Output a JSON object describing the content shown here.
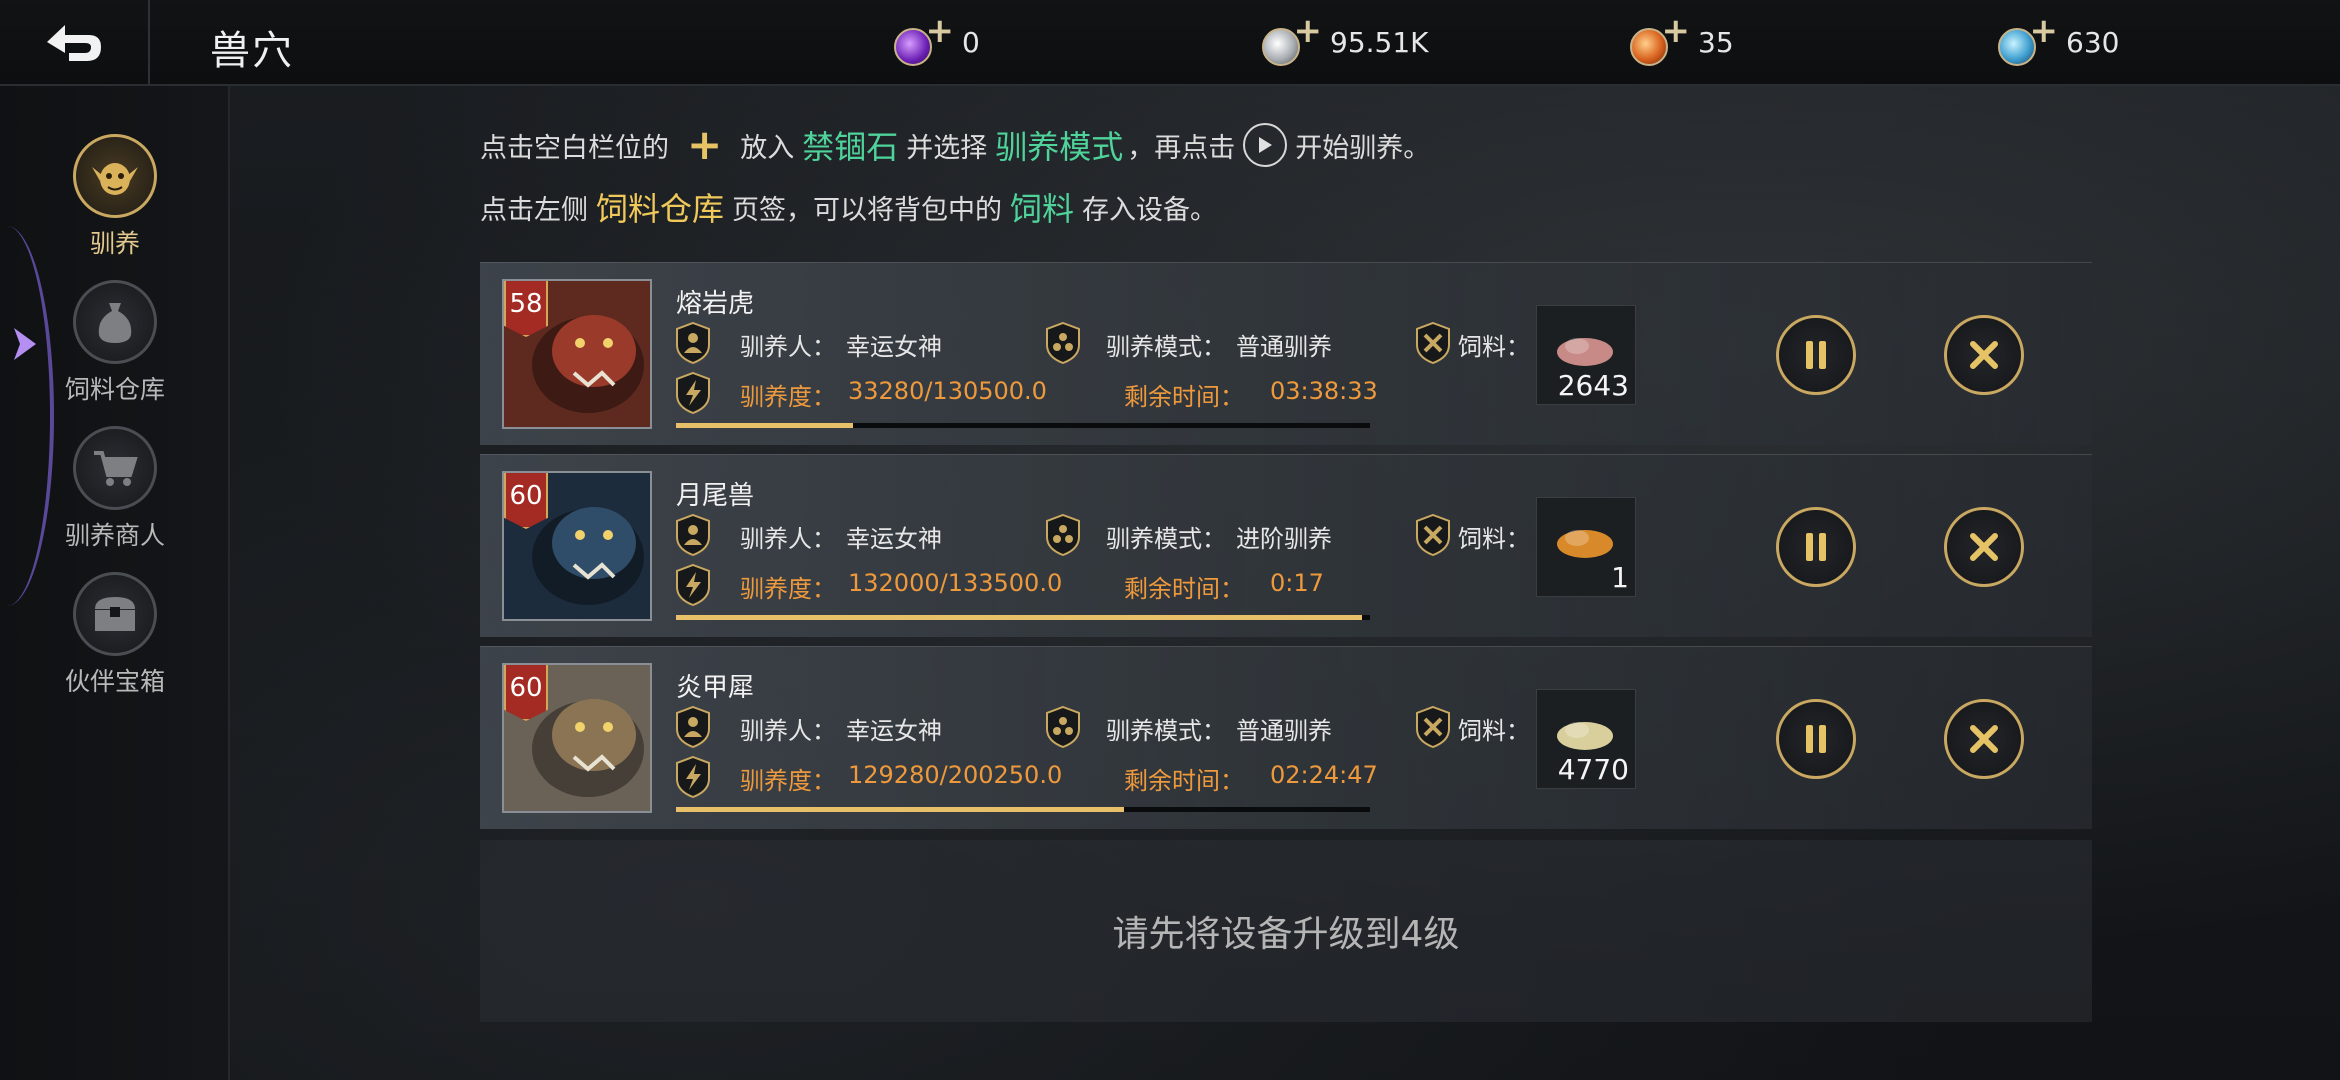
{
  "header": {
    "title": "兽穴",
    "currencies": [
      {
        "icon": "purple-gem-icon",
        "color": "#8a3fd6",
        "value": "0"
      },
      {
        "icon": "silver-coin-icon",
        "color": "#bfc4c9",
        "value": "95.51K"
      },
      {
        "icon": "orange-token-icon",
        "color": "#e2752a",
        "value": "35"
      },
      {
        "icon": "blue-crystal-icon",
        "color": "#3fa7d6",
        "value": "630"
      }
    ]
  },
  "sidebar": {
    "items": [
      {
        "label": "驯养",
        "icon": "goblin-face-icon",
        "active": true
      },
      {
        "label": "饲料仓库",
        "icon": "sack-icon",
        "active": false
      },
      {
        "label": "驯养商人",
        "icon": "cart-icon",
        "active": false
      },
      {
        "label": "伙伴宝箱",
        "icon": "treasure-chest-icon",
        "active": false
      }
    ]
  },
  "instructions": {
    "line1": {
      "a": "点击空白栏位的",
      "b": "放入",
      "c": "禁锢石",
      "d": "并选择",
      "e": "驯养模式",
      "f": "，再点击",
      "g": "开始驯养。"
    },
    "line2": {
      "a": "点击左侧",
      "b": "饲料仓库",
      "c": "页签，可以将背包中的",
      "d": "饲料",
      "e": "存入设备。"
    }
  },
  "tasks": [
    {
      "name": "熔岩虎",
      "level": "58",
      "trainer_label": "驯养人：",
      "trainer": "幸运女神",
      "mode_label": "驯养模式：",
      "mode": "普通驯养",
      "food_label": "饲料：",
      "progress_label": "驯养度：",
      "progress": "33280/130500.0",
      "time_label": "剩余时间：",
      "time": "03:38:33",
      "food_count": "2643",
      "fill": 0.255,
      "accent": "#7a2a1e"
    },
    {
      "name": "月尾兽",
      "level": "60",
      "trainer_label": "驯养人：",
      "trainer": "幸运女神",
      "mode_label": "驯养模式：",
      "mode": "进阶驯养",
      "food_label": "饲料：",
      "progress_label": "驯养度：",
      "progress": "132000/133500.0",
      "time_label": "剩余时间：",
      "time": "0:17",
      "food_count": "1",
      "fill": 0.989,
      "accent": "#24364a"
    },
    {
      "name": "炎甲犀",
      "level": "60",
      "trainer_label": "驯养人：",
      "trainer": "幸运女神",
      "mode_label": "驯养模式：",
      "mode": "普通驯养",
      "food_label": "饲料：",
      "progress_label": "驯养度：",
      "progress": "129280/200250.0",
      "time_label": "剩余时间：",
      "time": "02:24:47",
      "food_count": "4770",
      "fill": 0.646,
      "accent": "#6b5a3a"
    }
  ],
  "empty_slot": {
    "text": "请先将设备升级到4级"
  }
}
